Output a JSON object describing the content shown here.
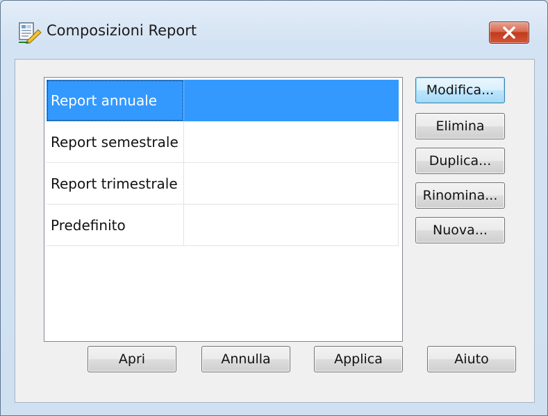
{
  "window": {
    "title": "Composizioni Report",
    "icon": "report-icon",
    "close_icon": "close-icon"
  },
  "list": {
    "rows": [
      {
        "name": "Report annuale",
        "value": "",
        "selected": true
      },
      {
        "name": "Report semestrale",
        "value": "",
        "selected": false
      },
      {
        "name": "Report trimestrale",
        "value": "",
        "selected": false
      },
      {
        "name": "Predefinito",
        "value": "",
        "selected": false
      }
    ]
  },
  "side_buttons": {
    "modifica": "Modifica...",
    "elimina": "Elimina",
    "duplica": "Duplica...",
    "rinomina": "Rinomina...",
    "nuova": "Nuova..."
  },
  "bottom_buttons": {
    "apri": "Apri",
    "annulla": "Annulla",
    "applica": "Applica",
    "aiuto": "Aiuto"
  },
  "colors": {
    "selection": "#3399ff",
    "default_button_border": "#3c7fb1",
    "close_button": "#c23a1c"
  }
}
